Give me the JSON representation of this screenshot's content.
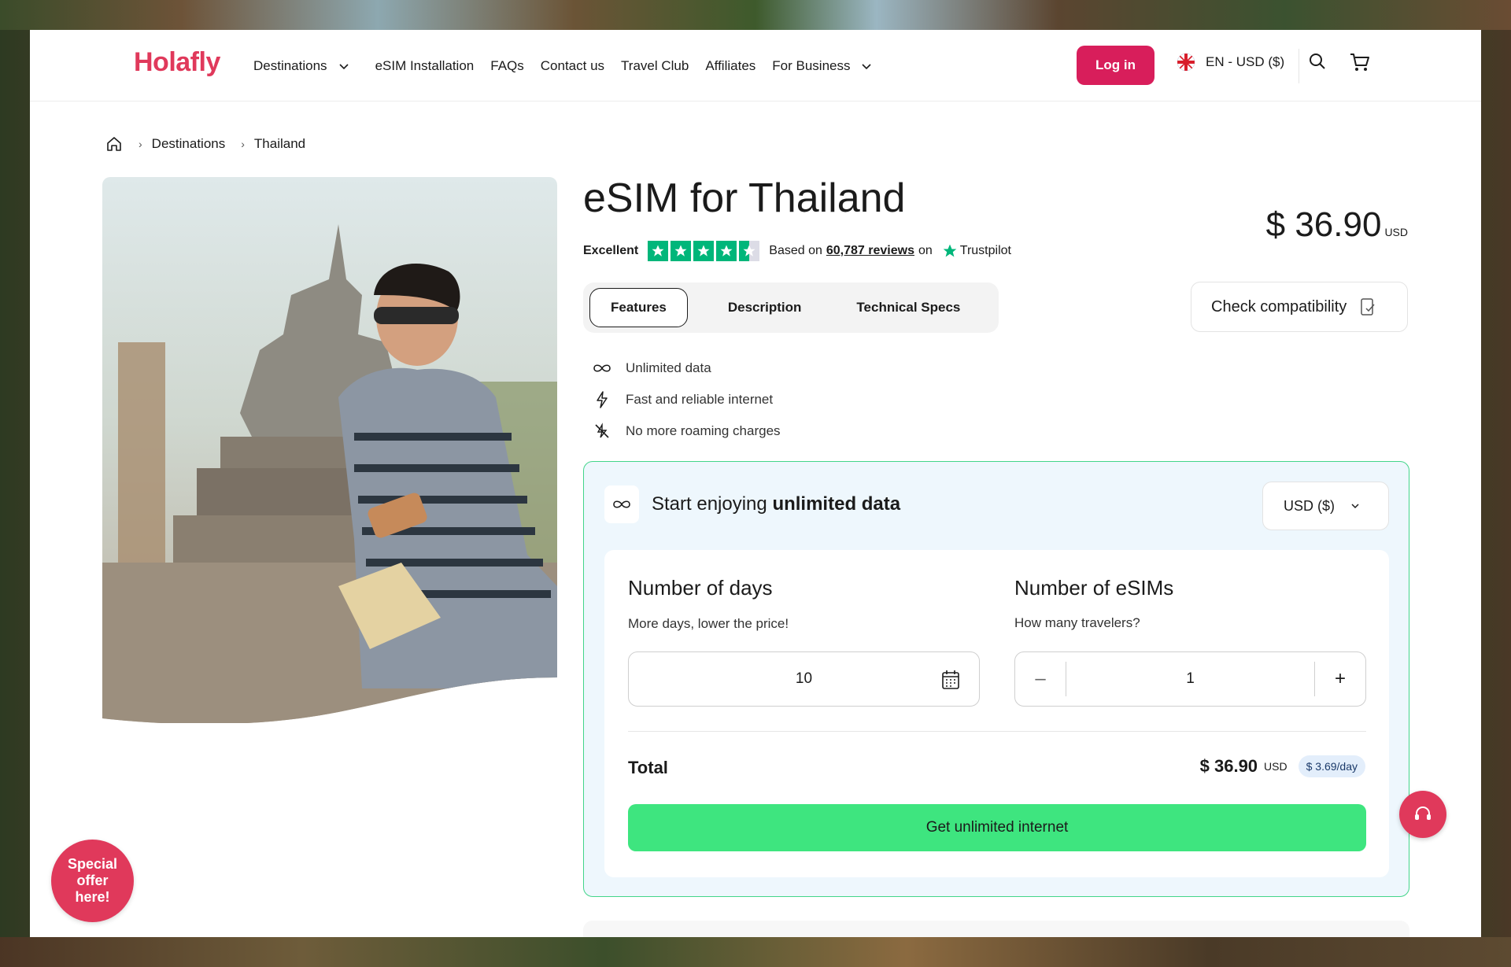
{
  "header": {
    "logo": "Holafly",
    "nav": [
      {
        "label": "Destinations",
        "has_dropdown": true
      },
      {
        "label": "eSIM Installation",
        "has_dropdown": false
      },
      {
        "label": "FAQs",
        "has_dropdown": false
      },
      {
        "label": "Contact us",
        "has_dropdown": false
      },
      {
        "label": "Travel Club",
        "has_dropdown": false
      },
      {
        "label": "Affiliates",
        "has_dropdown": false
      },
      {
        "label": "For Business",
        "has_dropdown": true
      }
    ],
    "login_label": "Log in",
    "language": "EN - USD ($)",
    "brand_color": "#d81e5b"
  },
  "breadcrumb": [
    "Destinations",
    "Thailand"
  ],
  "product": {
    "title": "eSIM for Thailand",
    "price": "$ 36.90",
    "price_unit": "USD",
    "rating_label": "Excellent",
    "stars": 4.5,
    "based_on": "Based on",
    "reviews": "60,787 reviews",
    "on": "on",
    "trustpilot": "Trustpilot"
  },
  "tabs": [
    "Features",
    "Description",
    "Technical Specs"
  ],
  "compat_label": "Check compatibility",
  "features": [
    {
      "icon": "infinity-icon",
      "label": "Unlimited data"
    },
    {
      "icon": "lightning-icon",
      "label": "Fast and reliable internet"
    },
    {
      "icon": "no-roaming-icon",
      "label": "No more roaming charges"
    }
  ],
  "plan": {
    "title_prefix": "Start enjoying",
    "title_bold": "unlimited data",
    "currency": "USD ($)",
    "days_heading": "Number of days",
    "days_sub": "More days, lower the price!",
    "days_value": "10",
    "esims_heading": "Number of eSIMs",
    "esims_sub": "How many travelers?",
    "esims_value": "1",
    "total_label": "Total",
    "total_amount": "$ 36.90",
    "total_unit": "USD",
    "per_day": "$ 3.69/day",
    "cta": "Get unlimited internet",
    "accent": "#43d58a"
  },
  "special_offer": "Special offer here!"
}
